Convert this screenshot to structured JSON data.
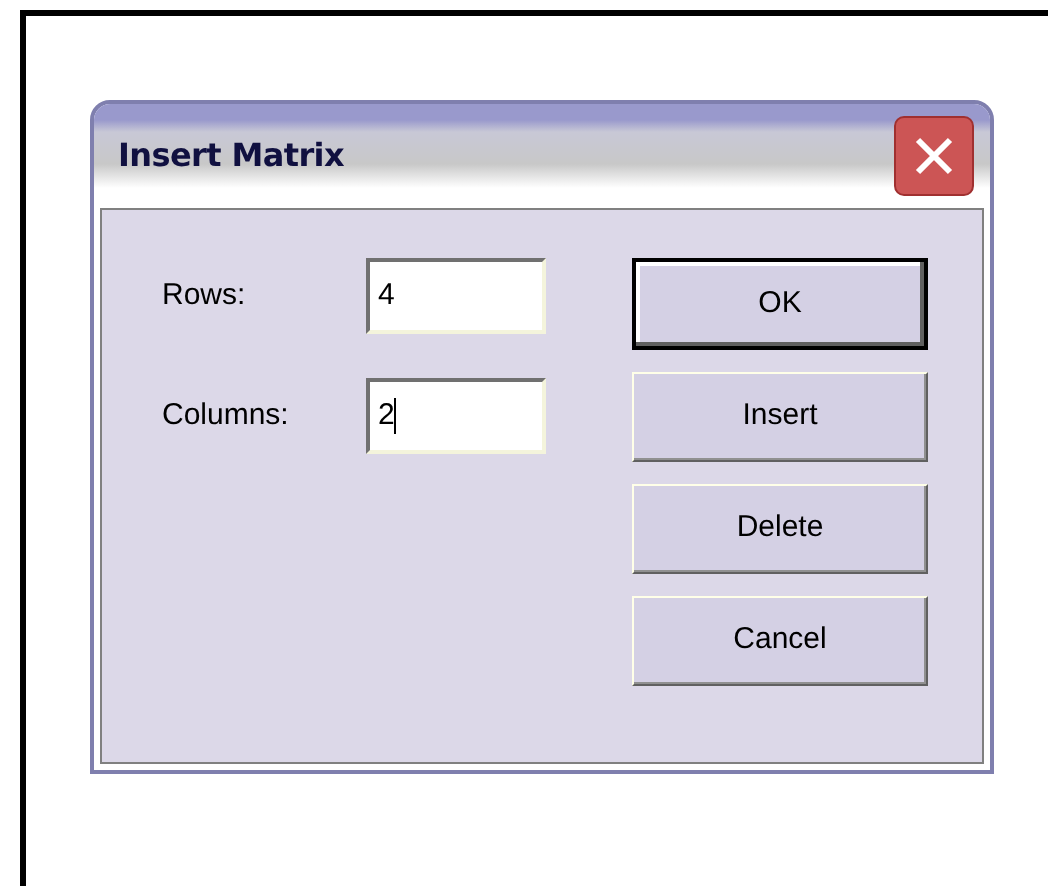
{
  "dialog": {
    "title": "Insert Matrix",
    "fields": [
      {
        "label": "Rows:",
        "value": "4",
        "focused": false
      },
      {
        "label": "Columns:",
        "value": "2",
        "focused": true
      }
    ],
    "buttons": [
      {
        "label": "OK",
        "default": true
      },
      {
        "label": "Insert",
        "default": false
      },
      {
        "label": "Delete",
        "default": false
      },
      {
        "label": "Cancel",
        "default": false
      }
    ]
  }
}
